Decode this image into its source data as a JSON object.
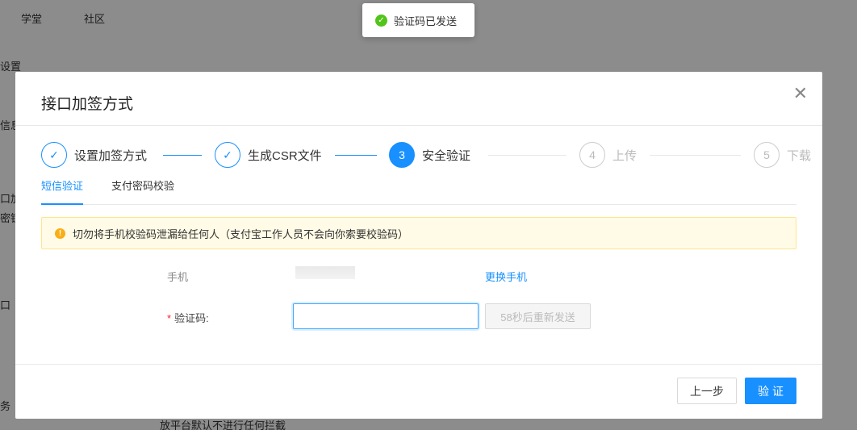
{
  "background": {
    "nav": [
      "学堂",
      "社区"
    ],
    "fragments": [
      "设置",
      "信息",
      "口加",
      "密钥",
      "口",
      "务",
      "放平台默认不进行任何拦截"
    ]
  },
  "toast": {
    "message": "验证码已发送",
    "icon": "check-circle-icon"
  },
  "modal": {
    "title": "接口加签方式",
    "close_icon": "close-icon",
    "steps": [
      {
        "index": "1",
        "label": "设置加签方式",
        "status": "finish"
      },
      {
        "index": "2",
        "label": "生成CSR文件",
        "status": "finish"
      },
      {
        "index": "3",
        "label": "安全验证",
        "status": "process"
      },
      {
        "index": "4",
        "label": "上传",
        "status": "wait"
      },
      {
        "index": "5",
        "label": "下载",
        "status": "wait"
      }
    ],
    "tabs": [
      {
        "label": "短信验证",
        "active": true
      },
      {
        "label": "支付密码校验",
        "active": false
      }
    ],
    "alert": {
      "icon": "warning-icon",
      "message": "切勿将手机校验码泄漏给任何人（支付宝工作人员不会向你索要校验码）"
    },
    "form": {
      "phone_label": "手机",
      "change_phone_link": "更换手机",
      "code_label": "验证码:",
      "required_mark": "*",
      "code_value": "",
      "resend_label": "58秒后重新发送"
    },
    "footer": {
      "prev_label": "上一步",
      "verify_label": "验证"
    }
  },
  "colors": {
    "primary": "#1890ff",
    "success": "#52c41a",
    "warning": "#faad14",
    "required": "#f5222d"
  }
}
